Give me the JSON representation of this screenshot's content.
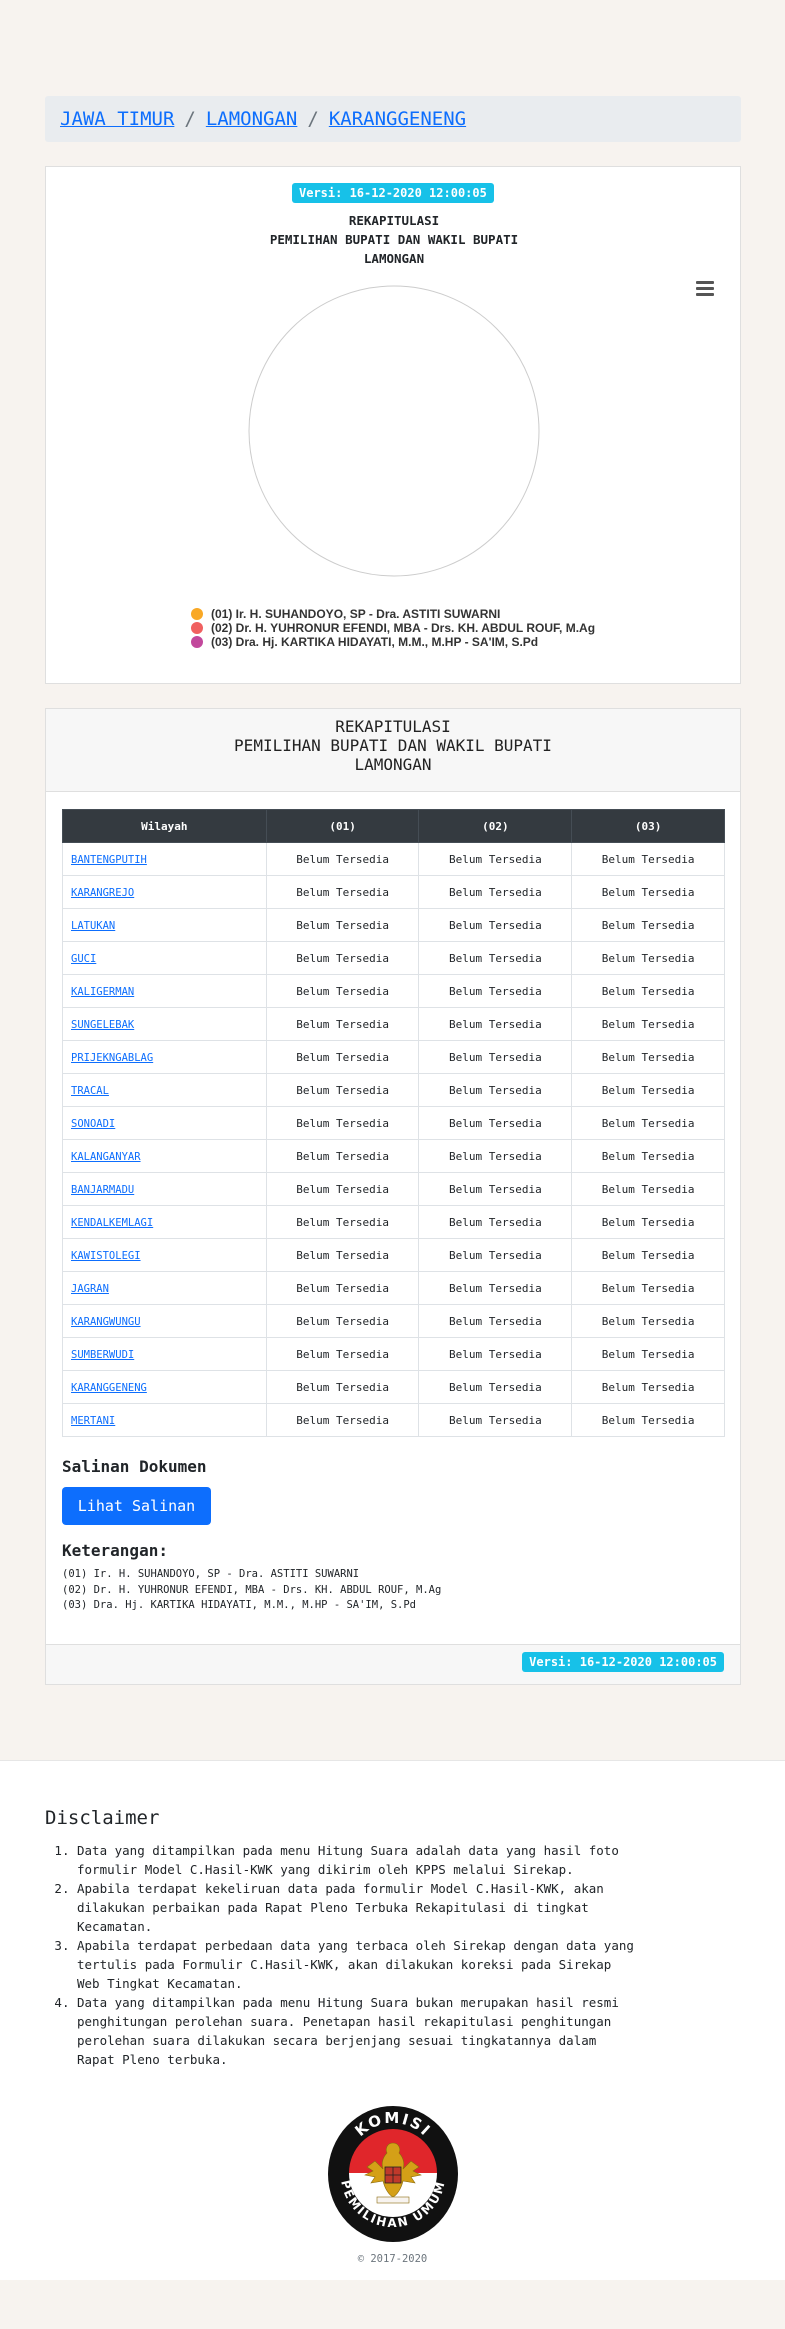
{
  "breadcrumb": {
    "items": [
      "JAWA TIMUR",
      "LAMONGAN",
      "KARANGGENENG"
    ],
    "separator": "/"
  },
  "version_badge": "Versi: 16-12-2020 12:00:05",
  "chart": {
    "title_lines": [
      "REKAPITULASI",
      "PEMILIHAN BUPATI DAN WAKIL BUPATI",
      "LAMONGAN"
    ],
    "menu_icon": "hamburger-icon",
    "legend": [
      {
        "label": "(01) Ir. H. SUHANDOYO, SP - Dra. ASTITI SUWARNI",
        "color": "#f9a825"
      },
      {
        "label": "(02) Dr. H. YUHRONUR EFENDI, MBA - Drs. KH. ABDUL ROUF, M.Ag",
        "color": "#f06060"
      },
      {
        "label": "(03) Dra. Hj. KARTIKA HIDAYATI, M.M., M.HP - SA'IM, S.Pd",
        "color": "#c2489c"
      }
    ]
  },
  "chart_data": {
    "type": "pie",
    "title": "REKAPITULASI PEMILIHAN BUPATI DAN WAKIL BUPATI LAMONGAN",
    "categories": [
      "(01) Ir. H. SUHANDOYO, SP - Dra. ASTITI SUWARNI",
      "(02) Dr. H. YUHRONUR EFENDI, MBA - Drs. KH. ABDUL ROUF, M.Ag",
      "(03) Dra. Hj. KARTIKA HIDAYATI, M.M., M.HP - SA'IM, S.Pd"
    ],
    "values": [
      0,
      0,
      0
    ],
    "legend_position": "bottom"
  },
  "table_card": {
    "header_lines": [
      "REKAPITULASI",
      "PEMILIHAN BUPATI DAN WAKIL BUPATI",
      "LAMONGAN"
    ],
    "columns": [
      "Wilayah",
      "(01)",
      "(02)",
      "(03)"
    ],
    "rows": [
      {
        "wilayah": "BANTENGPUTIH",
        "c1": "Belum Tersedia",
        "c2": "Belum Tersedia",
        "c3": "Belum Tersedia"
      },
      {
        "wilayah": "KARANGREJO",
        "c1": "Belum Tersedia",
        "c2": "Belum Tersedia",
        "c3": "Belum Tersedia"
      },
      {
        "wilayah": "LATUKAN",
        "c1": "Belum Tersedia",
        "c2": "Belum Tersedia",
        "c3": "Belum Tersedia"
      },
      {
        "wilayah": "GUCI",
        "c1": "Belum Tersedia",
        "c2": "Belum Tersedia",
        "c3": "Belum Tersedia"
      },
      {
        "wilayah": "KALIGERMAN",
        "c1": "Belum Tersedia",
        "c2": "Belum Tersedia",
        "c3": "Belum Tersedia"
      },
      {
        "wilayah": "SUNGELEBAK",
        "c1": "Belum Tersedia",
        "c2": "Belum Tersedia",
        "c3": "Belum Tersedia"
      },
      {
        "wilayah": "PRIJEKNGABLAG",
        "c1": "Belum Tersedia",
        "c2": "Belum Tersedia",
        "c3": "Belum Tersedia"
      },
      {
        "wilayah": "TRACAL",
        "c1": "Belum Tersedia",
        "c2": "Belum Tersedia",
        "c3": "Belum Tersedia"
      },
      {
        "wilayah": "SONOADI",
        "c1": "Belum Tersedia",
        "c2": "Belum Tersedia",
        "c3": "Belum Tersedia"
      },
      {
        "wilayah": "KALANGANYAR",
        "c1": "Belum Tersedia",
        "c2": "Belum Tersedia",
        "c3": "Belum Tersedia"
      },
      {
        "wilayah": "BANJARMADU",
        "c1": "Belum Tersedia",
        "c2": "Belum Tersedia",
        "c3": "Belum Tersedia"
      },
      {
        "wilayah": "KENDALKEMLAGI",
        "c1": "Belum Tersedia",
        "c2": "Belum Tersedia",
        "c3": "Belum Tersedia"
      },
      {
        "wilayah": "KAWISTOLEGI",
        "c1": "Belum Tersedia",
        "c2": "Belum Tersedia",
        "c3": "Belum Tersedia"
      },
      {
        "wilayah": "JAGRAN",
        "c1": "Belum Tersedia",
        "c2": "Belum Tersedia",
        "c3": "Belum Tersedia"
      },
      {
        "wilayah": "KARANGWUNGU",
        "c1": "Belum Tersedia",
        "c2": "Belum Tersedia",
        "c3": "Belum Tersedia"
      },
      {
        "wilayah": "SUMBERWUDI",
        "c1": "Belum Tersedia",
        "c2": "Belum Tersedia",
        "c3": "Belum Tersedia"
      },
      {
        "wilayah": "KARANGGENENG",
        "c1": "Belum Tersedia",
        "c2": "Belum Tersedia",
        "c3": "Belum Tersedia"
      },
      {
        "wilayah": "MERTANI",
        "c1": "Belum Tersedia",
        "c2": "Belum Tersedia",
        "c3": "Belum Tersedia"
      }
    ],
    "salinan_title": "Salinan Dokumen",
    "salinan_button": "Lihat Salinan",
    "keterangan_title": "Keterangan:",
    "keterangan": [
      "(01) Ir. H. SUHANDOYO, SP - Dra. ASTITI SUWARNI",
      "(02) Dr. H. YUHRONUR EFENDI, MBA - Drs. KH. ABDUL ROUF, M.Ag",
      "(03) Dra. Hj. KARTIKA HIDAYATI, M.M., M.HP - SA'IM, S.Pd"
    ]
  },
  "disclaimer": {
    "title": "Disclaimer",
    "items": [
      "Data yang ditampilkan pada menu Hitung Suara adalah data yang hasil foto formulir Model C.Hasil-KWK yang dikirim oleh KPPS melalui Sirekap.",
      "Apabila terdapat kekeliruan data pada formulir Model C.Hasil-KWK, akan dilakukan perbaikan pada Rapat Pleno Terbuka Rekapitulasi di tingkat Kecamatan.",
      "Apabila terdapat perbedaan data yang terbaca oleh Sirekap dengan data yang tertulis pada Formulir C.Hasil-KWK, akan dilakukan koreksi pada Sirekap Web Tingkat Kecamatan.",
      "Data yang ditampilkan pada menu Hitung Suara bukan merupakan hasil resmi penghitungan perolehan suara. Penetapan hasil rekapitulasi penghitungan perolehan suara dilakukan secara berjenjang sesuai tingkatannya dalam Rapat Pleno terbuka."
    ],
    "logo_top_text": "KOMISI",
    "logo_bottom_text": "PEMILIHAN UMUM",
    "copyright": "© 2017-2020"
  }
}
